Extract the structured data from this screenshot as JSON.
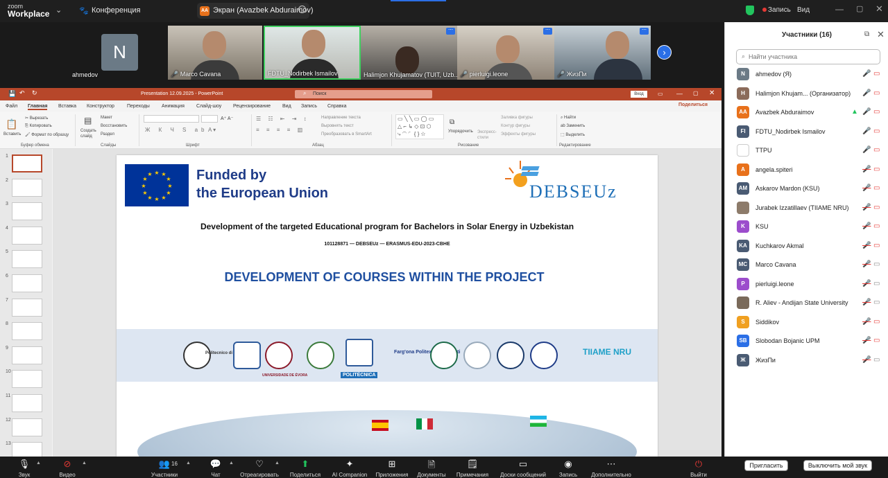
{
  "topbar": {
    "logo_small": "zoom",
    "logo_big": "Workplace",
    "meeting": "Конференция",
    "screen_avatar": "AA",
    "screen_label": "Экран (Avazbek Abduraimov)",
    "record_label": "Запись",
    "view_label": "Вид"
  },
  "videos": [
    {
      "name": "ahmedov",
      "initial": "N"
    },
    {
      "name": "Marco Cavana"
    },
    {
      "name": "FDTU_Nodirbek Ismailov"
    },
    {
      "name": "Halimjon Khujamatov (TUIT, Uzb..."
    },
    {
      "name": "pierluigi.leone"
    },
    {
      "name": "ЖизПи"
    }
  ],
  "ppt": {
    "title": "Presentation 12.09.2025  -  PowerPoint",
    "search_placeholder": "Поиск",
    "login": "Вход",
    "share": "Поделиться",
    "menu": [
      "Файл",
      "Главная",
      "Вставка",
      "Конструктор",
      "Переходы",
      "Анимация",
      "Слайд-шоу",
      "Рецензирование",
      "Вид",
      "Запись",
      "Справка"
    ],
    "ribbon": {
      "paste": "Вставить",
      "cut": "Вырезать",
      "copy": "Копировать",
      "format_painter": "Формат по образцу",
      "clipboard": "Буфер обмена",
      "new_slide": "Создать слайд",
      "layout": "Макет",
      "reset": "Восстановить",
      "section": "Раздел",
      "slides": "Слайды",
      "font": "Шрифт",
      "paragraph": "Абзац",
      "text_dir": "Направление текста",
      "align_text": "Выровнять текст",
      "smartart": "Преобразовать в SmartArt",
      "arrange": "Упорядочить",
      "quick_styles": "Экспресс-стили",
      "fill": "Заливка фигуры",
      "outline": "Контур фигуры",
      "effects": "Эффекты фигуры",
      "drawing": "Рисование",
      "find": "Найти",
      "replace": "Заменить",
      "select": "Выделить",
      "editing": "Редактирование"
    },
    "thumbnails": [
      "1",
      "2",
      "3",
      "4",
      "5",
      "6",
      "7",
      "8",
      "9",
      "10",
      "11",
      "12",
      "13"
    ]
  },
  "slide": {
    "funded_line1": "Funded by",
    "funded_line2": "the European Union",
    "brand": "DEBSEUz",
    "title": "Development of the targeted Educational program for Bachelors in Solar Energy in Uzbekistan",
    "code": "101128871 — DEBSEUz — ERASMUS-EDU-2023-CBHE",
    "heading": "DEVELOPMENT OF COURSES WITHIN THE PROJECT",
    "logos": {
      "polito": "Politecnico di Torino",
      "evora": "UNIVERSIDADE DE ÉVORA",
      "politecnica": "POLITÈCNICA",
      "fargona": "Farg'ona Politexnika Instituti",
      "tiiame": "TIIAME NRU"
    }
  },
  "participants": {
    "title": "Участники (16)",
    "search_placeholder": "Найти участника",
    "list": [
      {
        "initials": "N",
        "name": "ahmedov (Я)",
        "color": "#6b7a86",
        "mic": "on",
        "cam": "off"
      },
      {
        "initials": "H",
        "name": "Halimjon Khujam... (Организатор)",
        "color": "#8b6b5a",
        "mic": "on",
        "cam": "off"
      },
      {
        "initials": "AA",
        "name": "Avazbek Abduraimov",
        "color": "#e8711b",
        "mic": "share",
        "cam": "off"
      },
      {
        "initials": "FI",
        "name": "FDTU_Nodirbek Ismailov",
        "color": "#4a5b73",
        "mic": "on",
        "cam": "off"
      },
      {
        "initials": "",
        "name": "TTPU",
        "color": "#ffffff",
        "mic": "on",
        "cam": "off"
      },
      {
        "initials": "A",
        "name": "angela.spiteri",
        "color": "#e8711b",
        "mic": "muted",
        "cam": "off"
      },
      {
        "initials": "AM",
        "name": "Askarov Mardon (KSU)",
        "color": "#4a5b73",
        "mic": "muted",
        "cam": "off"
      },
      {
        "initials": "",
        "name": "Jurabek Izzatillaev (TIIAME NRU)",
        "color": "#8d7b6a",
        "mic": "muted",
        "cam": "off"
      },
      {
        "initials": "K",
        "name": "KSU",
        "color": "#9c4dcc",
        "mic": "muted",
        "cam": "off"
      },
      {
        "initials": "KA",
        "name": "Kuchkarov Akmal",
        "color": "#4a5b73",
        "mic": "muted",
        "cam": "off"
      },
      {
        "initials": "MC",
        "name": "Marco Cavana",
        "color": "#4a5b73",
        "mic": "muted",
        "cam": "on"
      },
      {
        "initials": "P",
        "name": "pierluigi.leone",
        "color": "#9c4dcc",
        "mic": "muted",
        "cam": "on"
      },
      {
        "initials": "",
        "name": "R. Aliev - Andijan State University",
        "color": "#7a6a5a",
        "mic": "muted",
        "cam": "on"
      },
      {
        "initials": "S",
        "name": "Siddikov",
        "color": "#f0a020",
        "mic": "muted",
        "cam": "off"
      },
      {
        "initials": "SB",
        "name": "Slobodan Bojanic UPM",
        "color": "#2b6fe6",
        "mic": "muted",
        "cam": "off"
      },
      {
        "initials": "Ж",
        "name": "ЖизПи",
        "color": "#4a5b73",
        "mic": "muted",
        "cam": "on"
      }
    ],
    "invite": "Пригласить",
    "mute_all": "Выключить мой звук"
  },
  "toolbar": {
    "audio": "Звук",
    "video": "Видео",
    "participants": "Участники",
    "participants_count": "16",
    "chat": "Чат",
    "react": "Отреагировать",
    "share": "Поделиться",
    "ai": "AI Companion",
    "apps": "Приложения",
    "docs": "Документы",
    "notes": "Примечания",
    "whiteboards": "Доски сообщений",
    "record": "Запись",
    "more": "Дополнительно",
    "leave": "Выйти"
  },
  "colors": {
    "ppt_accent": "#b7472a",
    "zoom_blue": "#2b6fe6",
    "muted_red": "#e53935",
    "eu_blue": "#003399"
  }
}
